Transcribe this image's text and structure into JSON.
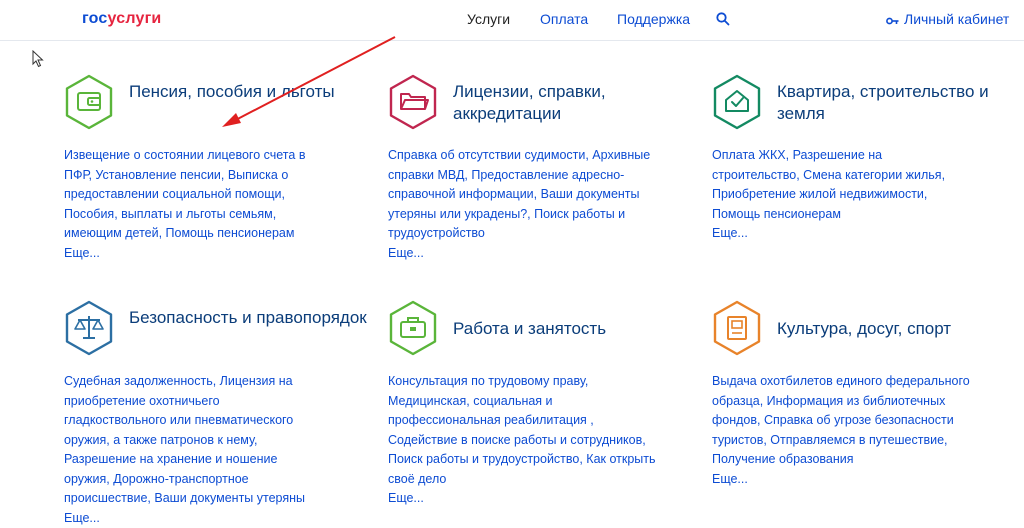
{
  "header": {
    "logo_gos": "гос",
    "logo_uslugi": "услуги",
    "nav": [
      "Услуги",
      "Оплата",
      "Поддержка"
    ],
    "cabinet_label": "Личный кабинет"
  },
  "cards": [
    {
      "title": "Пенсия, пособия и льготы",
      "color": "#5ab53a",
      "icon": "wallet-icon",
      "links": "Извещение о состоянии лицевого счета в ПФР, Установление пенсии, Выписка о предоставлении социальной помощи, Пособия, выплаты и льготы семьям, имеющим детей, Помощь пенсионерам",
      "more": "Еще..."
    },
    {
      "title": "Лицензии, справки, аккредитации",
      "color": "#c0264f",
      "icon": "folder-icon",
      "links": "Справка об отсутствии судимости, Архивные справки МВД, Предоставление адресно-справочной информации, Ваши документы утеряны или украдены?, Поиск работы и трудоустройство",
      "more": "Еще..."
    },
    {
      "title": "Квартира, строительство и земля",
      "color": "#138a62",
      "icon": "house-icon",
      "links": "Оплата ЖКХ, Разрешение на строительство, Смена категории жилья, Приобретение жилой недвижимости, Помощь пенсионерам",
      "more": "Еще..."
    },
    {
      "title": "Безопасность и правопорядок",
      "color": "#2c6fa3",
      "icon": "scales-icon",
      "links": "Судебная задолженность, Лицензия на приобретение охотничьего гладкоствольного или пневматического оружия, а также патронов к нему, Разрешение на хранение и ношение оружия, Дорожно-транспортное происшествие, Ваши документы утеряны",
      "more": "Еще..."
    },
    {
      "title": "Работа и занятость",
      "color": "#5ab53a",
      "icon": "briefcase-icon",
      "links": "Консультация по трудовому праву, Медицинская, социальная и профессиональная реабилитация , Содействие в поиске работы и сотрудников, Поиск работы и трудоустройство, Как открыть своё дело",
      "more": "Еще..."
    },
    {
      "title": "Культура, досуг, спорт",
      "color": "#e8832a",
      "icon": "book-icon",
      "links": "Выдача охотбилетов единого федерального образца, Информация из библиотечных фондов, Справка об угрозе безопасности туристов, Отправляемся в путешествие, Получение образования",
      "more": "Еще..."
    }
  ],
  "annotation": {
    "arrow_color": "#e02020"
  }
}
